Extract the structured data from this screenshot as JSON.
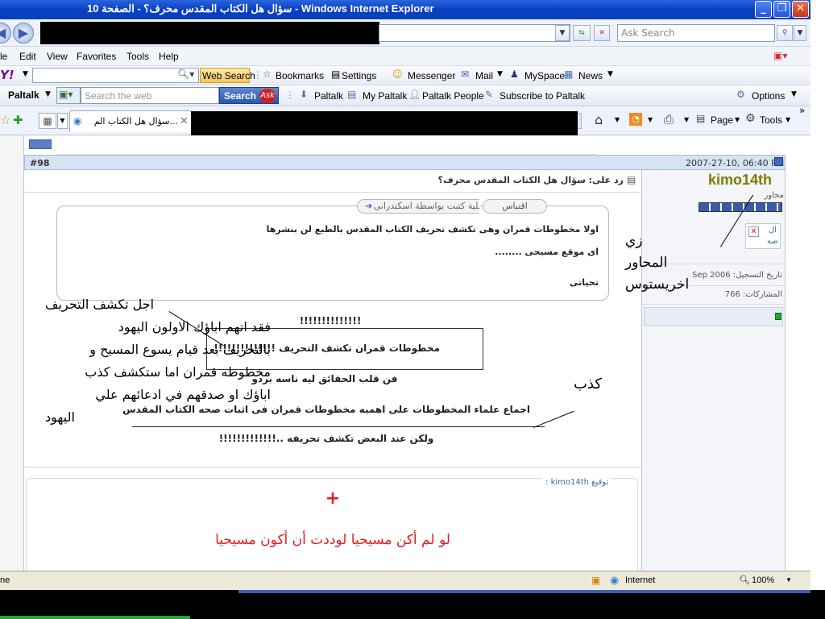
{
  "window": {
    "title": "سؤال هل الكتاب المقدس محرف؟ - الصفحة 10 - Windows Internet Explorer"
  },
  "addressbar": {
    "search_placeholder": "Ask Search"
  },
  "menu": [
    "le",
    "Edit",
    "View",
    "Favorites",
    "Tools",
    "Help"
  ],
  "toolbar1": {
    "web_search": "Web Search",
    "bookmarks": "Bookmarks",
    "settings": "Settings",
    "messenger": "Messenger",
    "mail": "Mail",
    "myspace": "MySpace",
    "news": "News"
  },
  "toolbar2": {
    "paltalk": "Paltalk",
    "search_placeholder": "Search the web",
    "search_button": "Search",
    "link_paltalk": "Paltalk",
    "link_mypaltalk": "My Paltalk",
    "link_people": "Paltalk People",
    "link_subscribe": "Subscribe to Paltalk",
    "options": "Options"
  },
  "toolbar3": {
    "tab_title": "...سؤال هل الكتاب الم",
    "page": "Page",
    "tools": "Tools"
  },
  "post": {
    "datetime": "2007-27-10, 06:40 PM",
    "number": "#98",
    "subject": "رد على: سؤال هل الكتاب المقدس محرف؟",
    "quote_button": "اقتباس",
    "original_link": "المشاركة الأصلية كتبت بواسطة اسكندرانى",
    "quote_lines": [
      "اولا مخطوطات قمران وهى تكشف تحريف الكتاب المقدس بالطبع لن بنشرها",
      "اى موقع مسيحى ........",
      "تحياتى"
    ],
    "body_lines": [
      "!!!!!!!!!!!!!!",
      "مخطوطات قمران تكشف التحريف !!!!!!!!!!!!!!",
      "فن قلب الحقائق ليه ناسه بردو",
      "اجماع علماء المخطوطات على اهميه مخطوطات قمران فى اثبات صحه الكتاب المقدس",
      "ولكن عند البعض تكشف تحريفه ..!!!!!!!!!!!!!"
    ],
    "signature_label": "توقيع kimo14th :",
    "signature_cross": "+",
    "signature_text": "لو لم أكن مسيحيا لوددت أن أكون مسيحيا"
  },
  "user": {
    "name": "kimo14th",
    "title": "محاور",
    "avatar_line1": "ال",
    "avatar_line2": "صه",
    "join_date": "تاريخ التسجيل: Sep 2006",
    "posts": "المشاركات: 766"
  },
  "annotations": {
    "left_block": [
      "اجل تكشف التحريف",
      "فقد اتهم اباؤك الاولون اليهود",
      "بالتحريف بعد قيام يسوع المسيح و",
      "مخطوطه قمران اما ستكشف كذب",
      "اباؤك او صدقهم في ادعائهم علي",
      "اليهود"
    ],
    "right_block": [
      "زي",
      "المحاور",
      "اخريستوس"
    ],
    "kidb": "كذب"
  },
  "statusbar": {
    "left": "ne",
    "zone": "Internet",
    "zoom": "100%"
  }
}
